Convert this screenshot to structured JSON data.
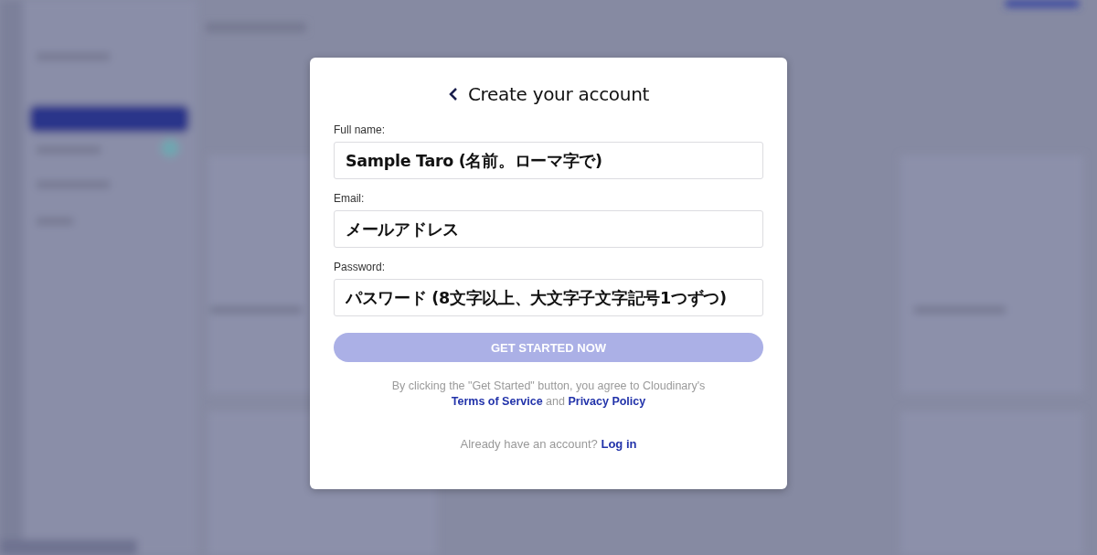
{
  "dialog": {
    "title": "Create your account",
    "fields": [
      {
        "label": "Full name:",
        "value": "Sample Taro (名前。ローマ字で)"
      },
      {
        "label": "Email:",
        "value": "メールアドレス"
      },
      {
        "label": "Password:",
        "value": "パスワード (8文字以上、大文字子文字記号1つずつ)"
      }
    ],
    "submit": {
      "label": "GET STARTED NOW",
      "disabled": true
    },
    "agreement": {
      "text": "By clicking the \"Get Started\" button, you agree to Cloudinary's",
      "terms_link": "Terms of Service",
      "joiner": "and",
      "privacy_link": "Privacy Policy"
    },
    "login": {
      "prompt": "Already have an account?",
      "link": "Log in"
    }
  }
}
